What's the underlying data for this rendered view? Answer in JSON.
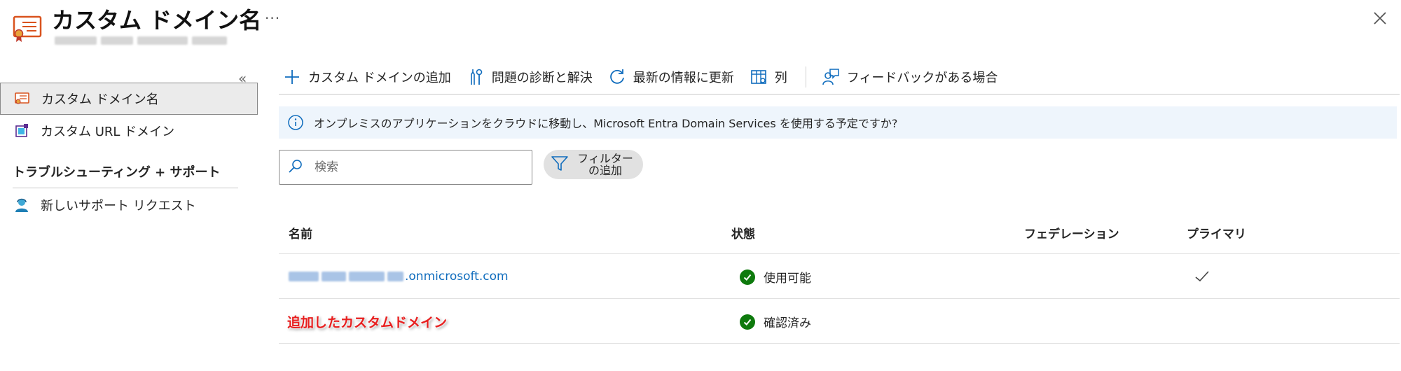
{
  "header": {
    "title": "カスタム ドメイン名",
    "more_label": "···",
    "icon": "certificate-icon",
    "close_icon": "close-icon"
  },
  "sidebar": {
    "collapse_label": "«",
    "items": [
      {
        "label": "カスタム ドメイン名",
        "icon": "certificate-icon",
        "active": true
      },
      {
        "label": "カスタム URL ドメイン",
        "icon": "custom-url-domain-icon",
        "active": false
      }
    ],
    "section_title": "トラブルシューティング + サポート",
    "support_items": [
      {
        "label": "新しいサポート リクエスト",
        "icon": "support-person-icon"
      }
    ]
  },
  "toolbar": {
    "add_label": "カスタム ドメインの追加",
    "diagnose_label": "問題の診断と解決",
    "refresh_label": "最新の情報に更新",
    "columns_label": "列",
    "feedback_label": "フィードバックがある場合"
  },
  "banner": {
    "text": "オンプレミスのアプリケーションをクラウドに移動し、Microsoft Entra Domain Services を使用する予定ですか?"
  },
  "search": {
    "placeholder": "検索"
  },
  "filter": {
    "label": "フィルターの追加"
  },
  "table": {
    "columns": [
      "名前",
      "状態",
      "フェデレーション",
      "プライマリ"
    ],
    "rows": [
      {
        "name_suffix": ".onmicrosoft.com",
        "status": "使用可能",
        "federation": "",
        "primary": true
      },
      {
        "name": "追加したカスタムドメイン",
        "status": "確認済み",
        "federation": "",
        "primary": false
      }
    ]
  },
  "colors": {
    "link": "#0f6cbd",
    "status_ok": "#0e7a0d",
    "banner_bg": "#eef5fc",
    "annotation": "#e81f1f",
    "icon_accent": "#d9531e"
  }
}
